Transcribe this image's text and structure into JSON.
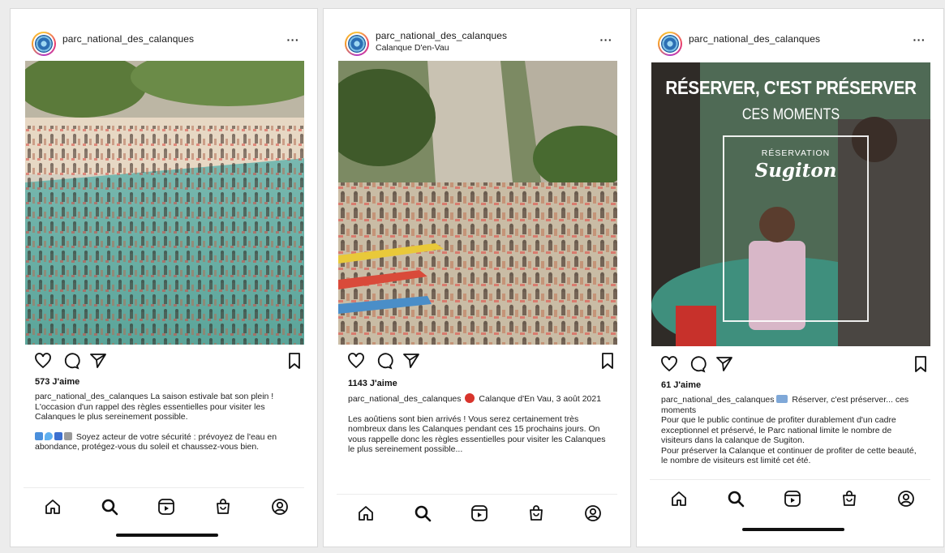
{
  "posts": [
    {
      "username": "parc_national_des_calanques",
      "location": "",
      "likes": "573 J'aime",
      "caption_user": "parc_national_des_calanques",
      "caption_text": "La saison estivale bat son plein ! L'occasion d'un rappel des règles essentielles pour visiter les Calanques le plus sereinement possible.",
      "caption_extra": "Soyez acteur de votre sécurité : prévoyez de l'eau en abondance, protégez-vous du soleil et chaussez-vous bien."
    },
    {
      "username": "parc_national_des_calanques",
      "location": "Calanque D'en-Vau",
      "likes": "1143 J'aime",
      "caption_user": "parc_national_des_calanques",
      "caption_text": "Calanque d'En Vau, 3 août 2021",
      "caption_extra": "Les aoûtiens sont bien arrivés ! Vous serez certainement très nombreux dans les Calanques pendant ces 15 prochains jours. On vous rappelle donc les règles essentielles pour visiter les Calanques le plus sereinement possible..."
    },
    {
      "username": "parc_national_des_calanques",
      "location": "",
      "likes": "61 J'aime",
      "caption_user": "parc_national_des_calanques",
      "caption_text": "Réserver, c'est préserver... ces moments",
      "caption_extra": "Pour que le public continue de profiter durablement d'un cadre exceptionnel et préservé, le Parc national limite le nombre de visiteurs dans la calanque de Sugiton.",
      "caption_extra2": "Pour préserver la Calanque et continuer de profiter de cette beauté, le nombre de visiteurs est limité cet été.",
      "poster": {
        "title": "RÉSERVER, C'EST PRÉSERVER",
        "subtitle": "CES MOMENTS",
        "kicker": "RÉSERVATION",
        "script": "Sugiton"
      }
    }
  ],
  "icons": {
    "more": "more-options-icon",
    "like": "heart-icon",
    "comment": "comment-icon",
    "share": "send-icon",
    "save": "bookmark-icon",
    "nav": [
      "home-icon",
      "search-icon",
      "reels-icon",
      "shop-icon",
      "profile-icon"
    ]
  },
  "more_label": "···",
  "colors": {
    "accent": "#111111",
    "story_ring": "#ea3d6c",
    "flag_red": "#d8342c"
  }
}
